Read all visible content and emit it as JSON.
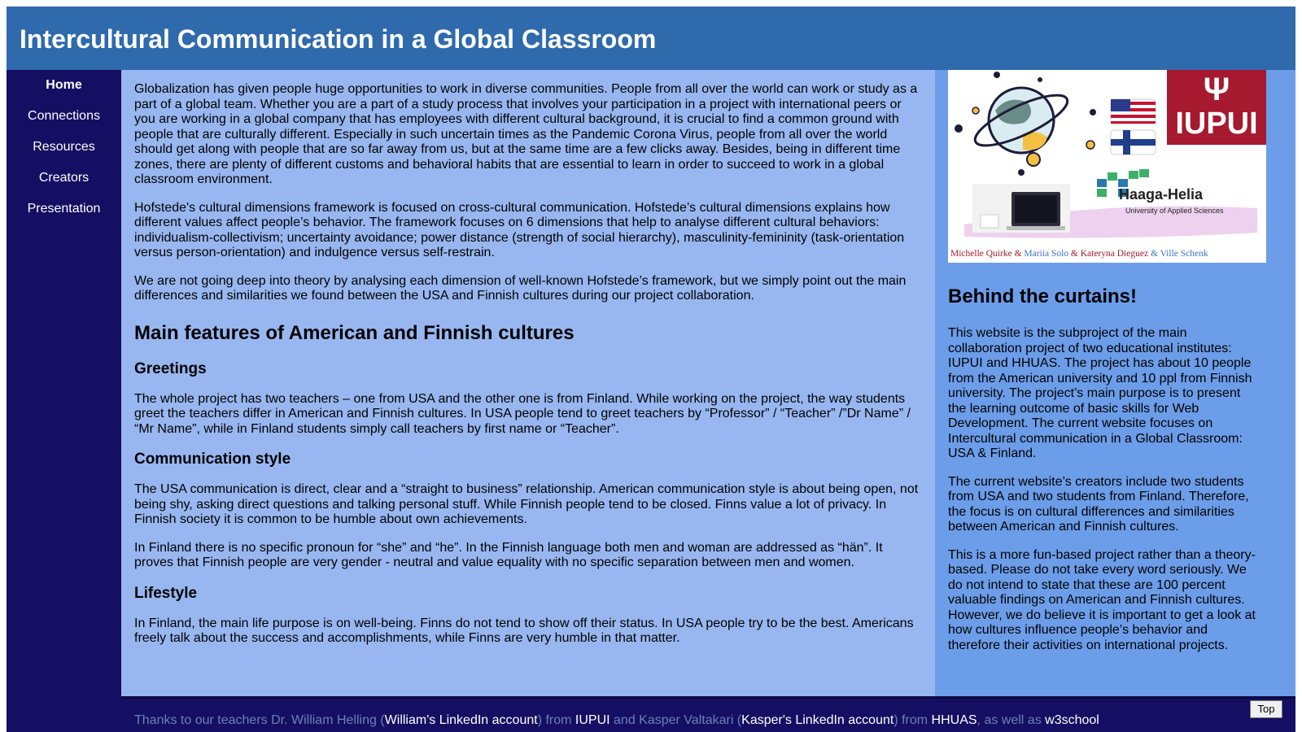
{
  "header": {
    "title": "Intercultural Communication in a Global Classroom"
  },
  "nav": {
    "items": [
      {
        "label": "Home"
      },
      {
        "label": "Connections"
      },
      {
        "label": "Resources"
      },
      {
        "label": "Creators"
      },
      {
        "label": "Presentation"
      }
    ]
  },
  "main": {
    "intro_p1": "Globalization has given people huge opportunities to work in diverse communities. People from all over the world can work or study as a part of a global team. Whether you are a part of a study process that involves your participation in a project with international peers or you are working in a global company that has employees with different cultural background, it is crucial to find a common ground with people that are culturally different. Especially in such uncertain times as the Pandemic Corona Virus, people from all over the world should get along with people that are so far away from us, but at the same time are a few clicks away. Besides, being in different time zones, there are plenty of different customs and behavioral habits that are essential to learn in order to succeed to work in a global classroom environment.",
    "intro_p2": "Hofstede's cultural dimensions framework is focused on cross-cultural communication. Hofstede’s cultural dimensions explains how different values affect people’s behavior. The framework focuses on 6 dimensions that help to analyse different cultural behaviors: individualism-collectivism; uncertainty avoidance; power distance (strength of social hierarchy), masculinity-femininity (task-orientation versus person-orientation) and indulgence versus self-restrain.",
    "intro_p3": "We are not going deep into theory by analysing each dimension of well-known Hofstede’s framework, but we simply point out the main differences and similarities we found between the USA and Finnish cultures during our project collaboration.",
    "features_heading": "Main features of American and Finnish cultures",
    "greetings_heading": "Greetings",
    "greetings_p": "The whole project has two teachers – one from USA and the other one is from Finland. While working on the project, the way students greet the teachers differ in American and Finnish cultures. In USA people tend to greet teachers by “Professor” / “Teacher” /”Dr Name” / “Mr Name”, while in Finland students simply call teachers by first name or “Teacher”.",
    "communication_heading": "Communication style",
    "communication_p1": "The USA communication is direct, clear and a “straight to business” relationship. American communication style is about being open, not being shy, asking direct questions and talking personal stuff. While Finnish people tend to be closed. Finns value a lot of privacy. In Finnish society it is common to be humble about own achievements.",
    "communication_p2": "In Finland there is no specific pronoun for “she” and “he”. In the Finnish language both men and woman are addressed as “hän”. It proves that Finnish people are very gender - neutral and value equality with no specific separation between men and women.",
    "lifestyle_heading": "Lifestyle",
    "lifestyle_p": "In Finland, the main life purpose is on well-being. Finns do not tend to show off their status. In USA people try to be the best. Americans freely talk about the success and accomplishments, while Finns are very humble in that matter."
  },
  "aside": {
    "banner": {
      "iupui_mark": "Ψ",
      "iupui_text": "IUPUI",
      "haaga_title": "Haaga-Helia",
      "haaga_sub": "University of Applied Sciences",
      "credit_1": "Michelle Quirke",
      "credit_amp1": " & ",
      "credit_2": "Mariia Solo",
      "credit_amp2": "  & ",
      "credit_3": "Kateryna Dieguez",
      "credit_amp3": " & ",
      "credit_4": "Ville Schenk"
    },
    "heading": "Behind the curtains!",
    "p1": "This website is the subproject of the main collaboration project of two educational institutes: IUPUI and HHUAS. The project has about 10 people from the American university and 10 ppl from Finnish university. The project’s main purpose is to present the learning outcome of basic skills for Web Development. The current website focuses on Intercultural communication in a Global Classroom: USA & Finland.",
    "p2": "The current website’s creators include two students from USA and two students from Finland. Therefore, the focus is on cultural differences and similarities between American and Finnish cultures.",
    "p3": "This is a more fun-based project rather than a theory-based. Please do not take every word seriously. We do not intend to state that these are 100 percent valuable findings on American and Finnish cultures. However, we do believe it is important to get a look at how cultures influence people’s behavior and therefore their activities on international projects."
  },
  "footer": {
    "text_1": "Thanks to our teachers Dr. William Helling (",
    "link_1": "William's LinkedIn account",
    "text_2": ") from ",
    "link_2": "IUPUI",
    "text_3": " and Kasper Valtakari (",
    "link_3": "Kasper's LinkedIn account",
    "text_4": ") from ",
    "link_4": "HHUAS",
    "text_5": ", as well as ",
    "link_5": "w3school",
    "top_button": "Top"
  },
  "colors": {
    "header_bg": "#2f6aad",
    "nav_bg": "#140f62",
    "main_bg": "#98b7f0",
    "aside_bg": "#6c9de9",
    "iupui_red": "#a6192e"
  }
}
